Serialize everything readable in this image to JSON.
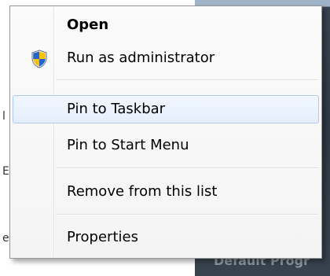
{
  "menu": {
    "items": [
      {
        "label": "Open",
        "bold": true
      },
      {
        "label": "Run as administrator",
        "icon": "shield-icon"
      },
      {
        "label": "Pin to Taskbar",
        "highlighted": true
      },
      {
        "label": "Pin to Start Menu"
      },
      {
        "label": "Remove from this list"
      },
      {
        "label": "Properties"
      }
    ]
  },
  "background": {
    "panel_label": "Default Progr",
    "left_fragments": [
      "l",
      "E",
      "e"
    ]
  },
  "colors": {
    "highlight_border": "#aeccf0",
    "highlight_fill": "#e4eefc",
    "shield_blue": "#2a63c7",
    "shield_yellow": "#f4c20d"
  }
}
